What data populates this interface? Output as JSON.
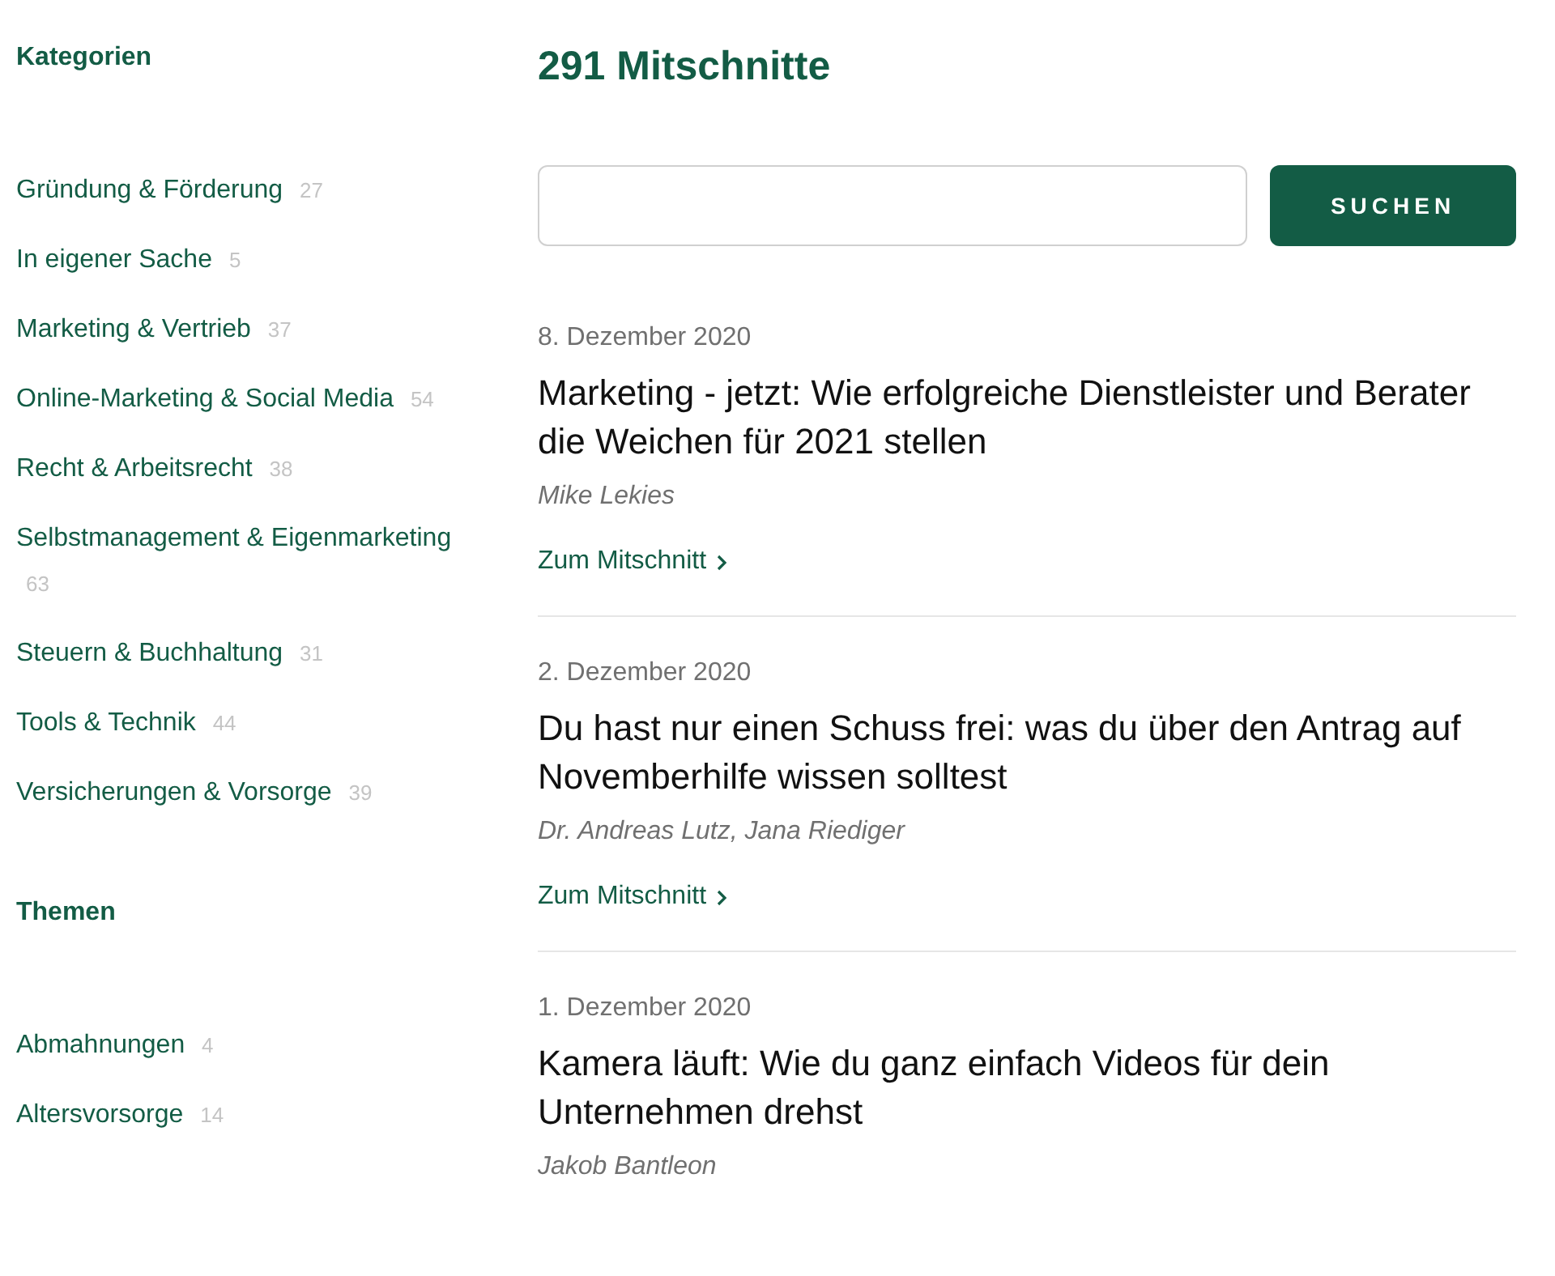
{
  "sidebar": {
    "sections": [
      {
        "title": "Kategorien",
        "items": [
          {
            "label": "Gründung & Förderung",
            "count": "27"
          },
          {
            "label": "In eigener Sache",
            "count": "5"
          },
          {
            "label": "Marketing & Vertrieb",
            "count": "37"
          },
          {
            "label": "Online-Marketing & Social Media",
            "count": "54"
          },
          {
            "label": "Recht & Arbeitsrecht",
            "count": "38"
          },
          {
            "label": "Selbstmanagement & Eigenmarketing",
            "count": "63"
          },
          {
            "label": "Steuern & Buchhaltung",
            "count": "31"
          },
          {
            "label": "Tools & Technik",
            "count": "44"
          },
          {
            "label": "Versicherungen & Vorsorge",
            "count": "39"
          }
        ]
      },
      {
        "title": "Themen",
        "items": [
          {
            "label": "Abmahnungen",
            "count": "4"
          },
          {
            "label": "Altersvorsorge",
            "count": "14"
          }
        ]
      }
    ]
  },
  "main": {
    "heading": "291 Mitschnitte",
    "search": {
      "button": "SUCHEN"
    },
    "articles": [
      {
        "date": "8. Dezember 2020",
        "title": "Marketing - jetzt: Wie erfolgreiche Dienstleister und Berater die Weichen für 2021 stellen",
        "author": "Mike Lekies",
        "link": "Zum Mitschnitt"
      },
      {
        "date": "2. Dezember 2020",
        "title": "Du hast nur einen Schuss frei: was du über den Antrag auf Novemberhilfe wissen solltest",
        "author": "Dr. Andreas Lutz, Jana Riediger",
        "link": "Zum Mitschnitt"
      },
      {
        "date": "1. Dezember 2020",
        "title": "Kamera läuft: Wie du ganz einfach Videos für dein Unternehmen drehst",
        "author": "Jakob Bantleon"
      }
    ]
  }
}
